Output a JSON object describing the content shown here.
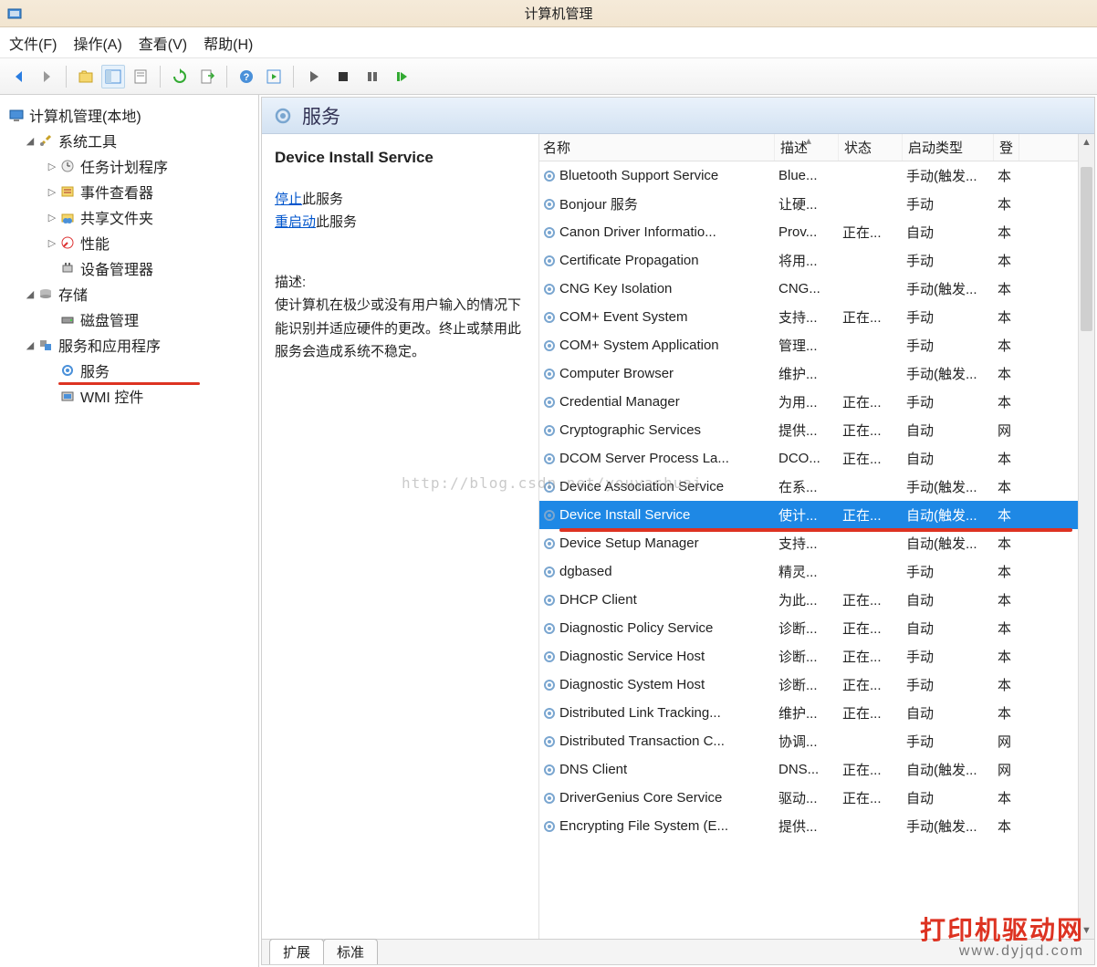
{
  "window": {
    "title": "计算机管理"
  },
  "menu": {
    "file": "文件(F)",
    "action": "操作(A)",
    "view": "查看(V)",
    "help": "帮助(H)"
  },
  "tree": {
    "root": "计算机管理(本地)",
    "sys_tools": "系统工具",
    "task_scheduler": "任务计划程序",
    "event_viewer": "事件查看器",
    "shared_folders": "共享文件夹",
    "performance": "性能",
    "device_manager": "设备管理器",
    "storage": "存储",
    "disk_mgmt": "磁盘管理",
    "svc_apps": "服务和应用程序",
    "services": "服务",
    "wmi": "WMI 控件"
  },
  "header": {
    "title": "服务"
  },
  "detail": {
    "name": "Device Install Service",
    "stop": "停止",
    "stop_suffix": "此服务",
    "restart": "重启动",
    "restart_suffix": "此服务",
    "desc_label": "描述:",
    "desc": "使计算机在极少或没有用户输入的情况下能识别并适应硬件的更改。终止或禁用此服务会造成系统不稳定。"
  },
  "columns": {
    "name": "名称",
    "desc": "描述",
    "status": "状态",
    "start": "启动类型",
    "logon": "登"
  },
  "services": [
    {
      "name": "Bluetooth Support Service",
      "desc": "Blue...",
      "status": "",
      "start": "手动(触发...",
      "logon": "本"
    },
    {
      "name": "Bonjour 服务",
      "desc": "让硬...",
      "status": "",
      "start": "手动",
      "logon": "本"
    },
    {
      "name": "Canon Driver Informatio...",
      "desc": "Prov...",
      "status": "正在...",
      "start": "自动",
      "logon": "本"
    },
    {
      "name": "Certificate Propagation",
      "desc": "将用...",
      "status": "",
      "start": "手动",
      "logon": "本"
    },
    {
      "name": "CNG Key Isolation",
      "desc": "CNG...",
      "status": "",
      "start": "手动(触发...",
      "logon": "本"
    },
    {
      "name": "COM+ Event System",
      "desc": "支持...",
      "status": "正在...",
      "start": "手动",
      "logon": "本"
    },
    {
      "name": "COM+ System Application",
      "desc": "管理...",
      "status": "",
      "start": "手动",
      "logon": "本"
    },
    {
      "name": "Computer Browser",
      "desc": "维护...",
      "status": "",
      "start": "手动(触发...",
      "logon": "本"
    },
    {
      "name": "Credential Manager",
      "desc": "为用...",
      "status": "正在...",
      "start": "手动",
      "logon": "本"
    },
    {
      "name": "Cryptographic Services",
      "desc": "提供...",
      "status": "正在...",
      "start": "自动",
      "logon": "网"
    },
    {
      "name": "DCOM Server Process La...",
      "desc": "DCO...",
      "status": "正在...",
      "start": "自动",
      "logon": "本"
    },
    {
      "name": "Device Association Service",
      "desc": "在系...",
      "status": "",
      "start": "手动(触发...",
      "logon": "本"
    },
    {
      "name": "Device Install Service",
      "desc": "使计...",
      "status": "正在...",
      "start": "自动(触发...",
      "logon": "本",
      "selected": true
    },
    {
      "name": "Device Setup Manager",
      "desc": "支持...",
      "status": "",
      "start": "自动(触发...",
      "logon": "本"
    },
    {
      "name": "dgbased",
      "desc": "精灵...",
      "status": "",
      "start": "手动",
      "logon": "本"
    },
    {
      "name": "DHCP Client",
      "desc": "为此...",
      "status": "正在...",
      "start": "自动",
      "logon": "本"
    },
    {
      "name": "Diagnostic Policy Service",
      "desc": "诊断...",
      "status": "正在...",
      "start": "自动",
      "logon": "本"
    },
    {
      "name": "Diagnostic Service Host",
      "desc": "诊断...",
      "status": "正在...",
      "start": "手动",
      "logon": "本"
    },
    {
      "name": "Diagnostic System Host",
      "desc": "诊断...",
      "status": "正在...",
      "start": "手动",
      "logon": "本"
    },
    {
      "name": "Distributed Link Tracking...",
      "desc": "维护...",
      "status": "正在...",
      "start": "自动",
      "logon": "本"
    },
    {
      "name": "Distributed Transaction C...",
      "desc": "协调...",
      "status": "",
      "start": "手动",
      "logon": "网"
    },
    {
      "name": "DNS Client",
      "desc": "DNS...",
      "status": "正在...",
      "start": "自动(触发...",
      "logon": "网"
    },
    {
      "name": "DriverGenius Core Service",
      "desc": "驱动...",
      "status": "正在...",
      "start": "自动",
      "logon": "本"
    },
    {
      "name": "Encrypting File System (E...",
      "desc": "提供...",
      "status": "",
      "start": "手动(触发...",
      "logon": "本"
    }
  ],
  "tabs": {
    "extended": "扩展",
    "standard": "标准"
  },
  "watermark": "http://blog.csdn.net/youyashuai",
  "brand": {
    "line1": "打印机驱动网",
    "line2": "www.dyjqd.com"
  }
}
